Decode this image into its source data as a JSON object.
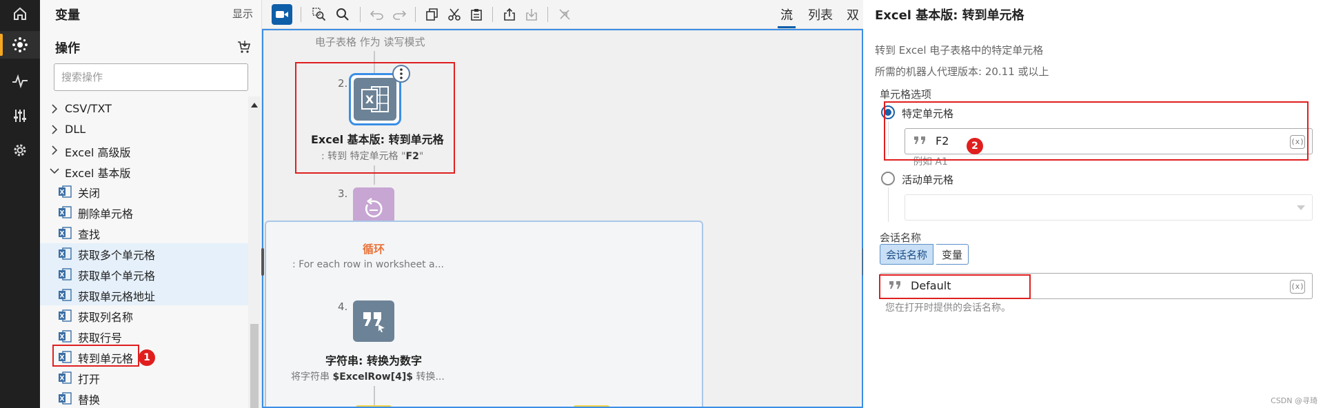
{
  "sidebar_nav": {
    "items": [
      "home-icon",
      "actions-icon",
      "activity-icon",
      "controls-icon",
      "settings-icon"
    ],
    "active_index": 1,
    "accent": "#f6a821"
  },
  "panel": {
    "variables_title": "变量",
    "show_label": "显示",
    "actions_title": "操作",
    "search_placeholder": "搜索操作",
    "categories": [
      {
        "label": "CSV/TXT",
        "expanded": false
      },
      {
        "label": "DLL",
        "expanded": false
      },
      {
        "label": "Excel 高级版",
        "expanded": false
      },
      {
        "label": "Excel 基本版",
        "expanded": true
      }
    ],
    "items": [
      "关闭",
      "删除单元格",
      "查找",
      "获取多个单元格",
      "获取单个单元格",
      "获取单元格地址",
      "获取列名称",
      "获取行号",
      "转到单元格",
      "打开",
      "替换"
    ],
    "highlighted_items": [
      3,
      4,
      5
    ]
  },
  "toolbar": {
    "view_tabs": [
      "流",
      "列表",
      "双"
    ],
    "active_view": 0
  },
  "canvas": {
    "prev_step_text": "电子表格 作为 读写模式",
    "step2": {
      "num": "2.",
      "title": "Excel 基本版: 转到单元格",
      "sub_prefix": ": 转到 特定单元格 \"",
      "sub_value": "F2",
      "sub_suffix": "\""
    },
    "step3": {
      "num": "3.",
      "title": "循环",
      "sub": ": For each row in worksheet a..."
    },
    "step4": {
      "num": "4.",
      "title": "字符串: 转换为数字",
      "sub_prefix": "将字符串 ",
      "sub_var": "$ExcelRow[4]$",
      "sub_suffix": " 转换..."
    }
  },
  "props": {
    "title": "Excel 基本版: 转到单元格",
    "description": "转到 Excel 电子表格中的特定单元格",
    "version": "所需的机器人代理版本: 20.11 或以上",
    "cell_options_label": "单元格选项",
    "radio_specific": "特定单元格",
    "specific_value": "F2",
    "specific_help": "例如 A1",
    "radio_active": "活动单元格",
    "session_label": "会话名称",
    "seg_session": "会话名称",
    "seg_variable": "变量",
    "session_value": "Default",
    "session_help": "您在打开时提供的会话名称。",
    "var_icon": "(x)"
  },
  "annotations": {
    "badge1": "1",
    "badge2": "2",
    "color": "#e01e1e"
  },
  "watermark": "CSDN @寻琦"
}
